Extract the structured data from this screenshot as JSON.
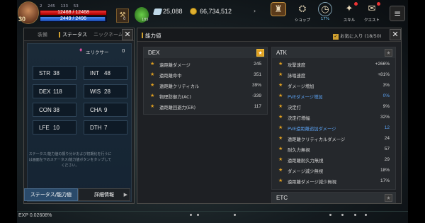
{
  "hud": {
    "level": "30",
    "stats": [
      "2",
      "245",
      "133",
      "53"
    ],
    "hp": "12468 / 12468",
    "mp": "2449 / 2496",
    "bag_count": "0",
    "potion_count": "185",
    "gems": "25,088",
    "gold": "66,734,512",
    "menu": [
      {
        "label": "",
        "icon": "castle-icon"
      },
      {
        "label": "ショップ",
        "icon": "shop-icon"
      },
      {
        "label": "17%",
        "icon": "clock-icon"
      },
      {
        "label": "スキル",
        "icon": "skill-icon"
      },
      {
        "label": "クエスト",
        "icon": "quest-icon"
      }
    ]
  },
  "left_panel": {
    "tabs": [
      "装備",
      "ステータス",
      "ニックネーム"
    ],
    "elixir_label": "エリクサー",
    "elixir_value": "0",
    "stats": [
      {
        "k": "STR",
        "v": "38"
      },
      {
        "k": "INT",
        "v": "48"
      },
      {
        "k": "DEX",
        "v": "118"
      },
      {
        "k": "WIS",
        "v": "28"
      },
      {
        "k": "CON",
        "v": "38"
      },
      {
        "k": "CHA",
        "v": "9"
      },
      {
        "k": "LFE",
        "v": "10"
      },
      {
        "k": "DTH",
        "v": "7"
      }
    ],
    "note": "ステータス/能力値の振り分けおよび初期化を行うには画面左下のステータス/能力値ボタンをタップしてください。",
    "btn_status": "ステータス/能力値",
    "btn_detail": "詳細情報"
  },
  "right_panel": {
    "title": "能力値",
    "fav_label": "お気に入り (18/50)",
    "dex": {
      "title": "DEX",
      "rows": [
        {
          "n": "遠距離ダメージ",
          "v": "245"
        },
        {
          "n": "遠距離命中",
          "v": "351"
        },
        {
          "n": "遠距離クリティカル",
          "v": "39%"
        },
        {
          "n": "物理防御力(AC)",
          "v": "-339"
        },
        {
          "n": "遠距離回避力(ER)",
          "v": "117"
        }
      ]
    },
    "atk": {
      "title": "ATK",
      "rows": [
        {
          "n": "攻撃速度",
          "v": "+266%"
        },
        {
          "n": "詠唱速度",
          "v": "+81%"
        },
        {
          "n": "ダメージ増加",
          "v": "3%"
        },
        {
          "n": "PVEダメージ増加",
          "v": "0%"
        },
        {
          "n": "決定打",
          "v": "9%"
        },
        {
          "n": "決定打増幅",
          "v": "32%"
        },
        {
          "n": "PVE遠距離追加ダメージ",
          "v": "12"
        },
        {
          "n": "遠距離クリティカルダメージ",
          "v": "24"
        },
        {
          "n": "耐久力無視",
          "v": "57"
        },
        {
          "n": "遠距離耐久力無視",
          "v": "29"
        },
        {
          "n": "ダメージ減少無視",
          "v": "18%"
        },
        {
          "n": "遠距離ダメージ減少無視",
          "v": "17%"
        }
      ]
    },
    "etc_title": "ETC"
  },
  "exp": "EXP 0.02608%",
  "colors": {
    "accent": "#d0a030",
    "blue_stat": "#5aa0f0",
    "star": "#e0a020"
  }
}
